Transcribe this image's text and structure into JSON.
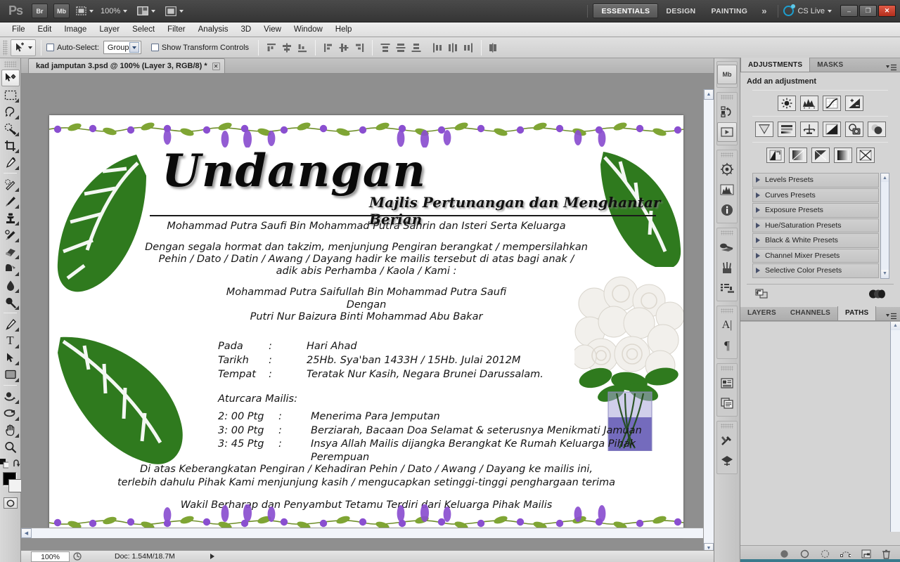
{
  "app": {
    "name": "Adobe Photoshop CS5",
    "logo": "Ps",
    "zoom_level": "100%"
  },
  "titlebar": {
    "bridge_label": "Br",
    "minibridge_label": "Mb",
    "workspaces": [
      {
        "label": "ESSENTIALS",
        "active": true
      },
      {
        "label": "DESIGN",
        "active": false
      },
      {
        "label": "PAINTING",
        "active": false
      }
    ],
    "more_workspaces": "»",
    "cs_live": "CS Live",
    "window_controls": {
      "minimize": "–",
      "restore": "❐",
      "close": "✕"
    }
  },
  "menubar": {
    "items": [
      "File",
      "Edit",
      "Image",
      "Layer",
      "Select",
      "Filter",
      "Analysis",
      "3D",
      "View",
      "Window",
      "Help"
    ]
  },
  "optionsbar": {
    "auto_select_label": "Auto-Select:",
    "auto_select_value": "Group",
    "show_transform_label": "Show Transform Controls"
  },
  "toolbar": {
    "tools": [
      {
        "name": "move-tool",
        "selected": true
      },
      {
        "name": "rectangular-marquee-tool",
        "selected": false
      },
      {
        "name": "lasso-tool",
        "selected": false
      },
      {
        "name": "quick-selection-tool",
        "selected": false
      },
      {
        "name": "crop-tool",
        "selected": false
      },
      {
        "name": "eyedropper-tool",
        "selected": false
      },
      {
        "name": "spot-healing-brush-tool",
        "selected": false
      },
      {
        "name": "brush-tool",
        "selected": false
      },
      {
        "name": "clone-stamp-tool",
        "selected": false
      },
      {
        "name": "history-brush-tool",
        "selected": false
      },
      {
        "name": "eraser-tool",
        "selected": false
      },
      {
        "name": "gradient-tool",
        "selected": false
      },
      {
        "name": "blur-tool",
        "selected": false
      },
      {
        "name": "dodge-tool",
        "selected": false
      },
      {
        "name": "pen-tool",
        "selected": false
      },
      {
        "name": "horizontal-type-tool",
        "selected": false
      },
      {
        "name": "path-selection-tool",
        "selected": false
      },
      {
        "name": "rectangle-shape-tool",
        "selected": false
      },
      {
        "name": "3d-object-rotate-tool",
        "selected": false
      },
      {
        "name": "3d-camera-rotate-tool",
        "selected": false
      },
      {
        "name": "hand-tool",
        "selected": false
      },
      {
        "name": "zoom-tool",
        "selected": false
      }
    ],
    "type_tool_glyph": "T",
    "foreground_color": "#000000",
    "background_color": "#f2f2f2"
  },
  "document": {
    "tab_title": "kad jamputan 3.psd @ 100% (Layer 3, RGB/8) *",
    "close_glyph": "✕",
    "status_zoom": "100%",
    "status_doc": "Doc: 1.54M/18.7M"
  },
  "invitation": {
    "title": "Undangan",
    "subtitle": "Majlis Pertunangan dan Menghantar Berian",
    "host_line": "Mohammad Putra Saufi Bin Mohammad Putra Sahrin dan Isteri Serta Keluarga",
    "request_lines": [
      "Dengan segala hormat dan takzim, menjunjung Pengiran berangkat / mempersilahkan",
      "Pehin / Dato / Datin / Awang / Dayang hadir ke mailis tersebut di atas bagi anak /",
      "adik abis Perhamba / Kaola / Kami :"
    ],
    "couple": {
      "groom": "Mohammad Putra Saifullah Bin Mohammad Putra Saufi",
      "conjunction": "Dengan",
      "bride": "Putri Nur Baizura Binti Mohammad Abu Bakar"
    },
    "details": [
      {
        "key": "Pada",
        "sep": ":",
        "value": "Hari Ahad"
      },
      {
        "key": "Tarikh",
        "sep": ":",
        "value": "25Hb. Sya'ban 1433H / 15Hb. Julai 2012M"
      },
      {
        "key": "Tempat",
        "sep": ":",
        "value": "Teratak Nur Kasih, Negara Brunei Darussalam."
      }
    ],
    "schedule_heading": "Aturcara Mailis:",
    "schedule": [
      {
        "time": "2: 00 Ptg",
        "sep": ":",
        "activity": "Menerima Para Jemputan",
        "activity2": ""
      },
      {
        "time": "3: 00 Ptg",
        "sep": ":",
        "activity": "Berziarah, Bacaan Doa Selamat & seterusnya Menikmati Jamuan",
        "activity2": ""
      },
      {
        "time": "3: 45 Ptg",
        "sep": ":",
        "activity": "Insya Allah Mailis dijangka Berangkat Ke Rumah Keluarga Pihak",
        "activity2": "Perempuan"
      }
    ],
    "closing_lines": [
      "Di atas Keberangkatan Pengiran / Kehadiran Pehin / Dato / Awang / Dayang ke mailis ini,",
      "terlebih  dahulu Pihak Kami menjunjung kasih / mengucapkan  setinggi-tinggi penghargaan terima"
    ],
    "footer_line": "Wakil Berharap dan Penyambut Tetamu Terdiri dari Keluarga Pihak Mailis",
    "colors": {
      "flower": "#8a4fd0",
      "leaf": "#2f7a1e",
      "vase": "#5a4fb0"
    }
  },
  "panels": {
    "top_tabs": [
      {
        "label": "ADJUSTMENTS",
        "active": true
      },
      {
        "label": "MASKS",
        "active": false
      }
    ],
    "adjustments_title": "Add an adjustment",
    "adjustment_icons": [
      [
        "brightness-contrast-icon",
        "levels-icon",
        "curves-icon",
        "exposure-icon"
      ],
      [
        "vibrance-icon",
        "hue-saturation-icon",
        "color-balance-icon",
        "black-white-icon",
        "photo-filter-icon",
        "channel-mixer-icon"
      ],
      [
        "invert-icon",
        "posterize-icon",
        "threshold-icon",
        "gradient-map-icon",
        "selective-color-icon"
      ]
    ],
    "presets": [
      "Levels Presets",
      "Curves Presets",
      "Exposure Presets",
      "Hue/Saturation Presets",
      "Black & White Presets",
      "Channel Mixer Presets",
      "Selective Color Presets"
    ],
    "bottom_tabs": [
      {
        "label": "LAYERS",
        "active": false
      },
      {
        "label": "CHANNELS",
        "active": false
      },
      {
        "label": "PATHS",
        "active": true
      }
    ],
    "paths_footer_icons": [
      "fill-path-icon",
      "stroke-path-icon",
      "load-selection-icon",
      "make-work-path-icon",
      "new-path-icon",
      "delete-path-icon"
    ]
  },
  "dock": {
    "icons": [
      "mini-bridge-icon",
      "history-icon",
      "actions-icon",
      "navigator-icon",
      "histogram-icon",
      "info-icon",
      "color-icon",
      "brush-icon",
      "brush-presets-icon",
      "character-icon",
      "paragraph-icon",
      "layer-comps-icon",
      "clone-source-icon",
      "tool-presets-icon",
      "3d-icon"
    ]
  }
}
